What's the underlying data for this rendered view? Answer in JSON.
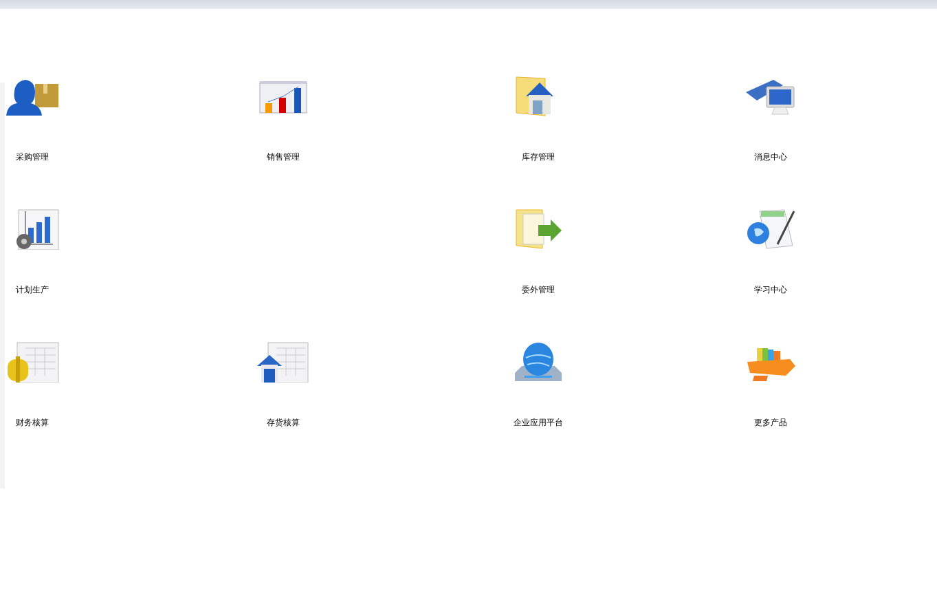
{
  "modules": [
    {
      "label": "采购管理",
      "kind": "purchase"
    },
    {
      "label": "销售管理",
      "kind": "sales"
    },
    {
      "label": "库存管理",
      "kind": "inventory"
    },
    {
      "label": "消息中心",
      "kind": "messages"
    },
    {
      "label": "计划生产",
      "kind": "planning"
    },
    {
      "kind": "blank"
    },
    {
      "label": "委外管理",
      "kind": "outsourcing"
    },
    {
      "label": "学习中心",
      "kind": "learning"
    },
    {
      "label": "财务核算",
      "kind": "finance"
    },
    {
      "label": "存货核算",
      "kind": "stock-accounting"
    },
    {
      "label": "企业应用平台",
      "kind": "platform"
    },
    {
      "label": "更多产品",
      "kind": "more"
    }
  ]
}
